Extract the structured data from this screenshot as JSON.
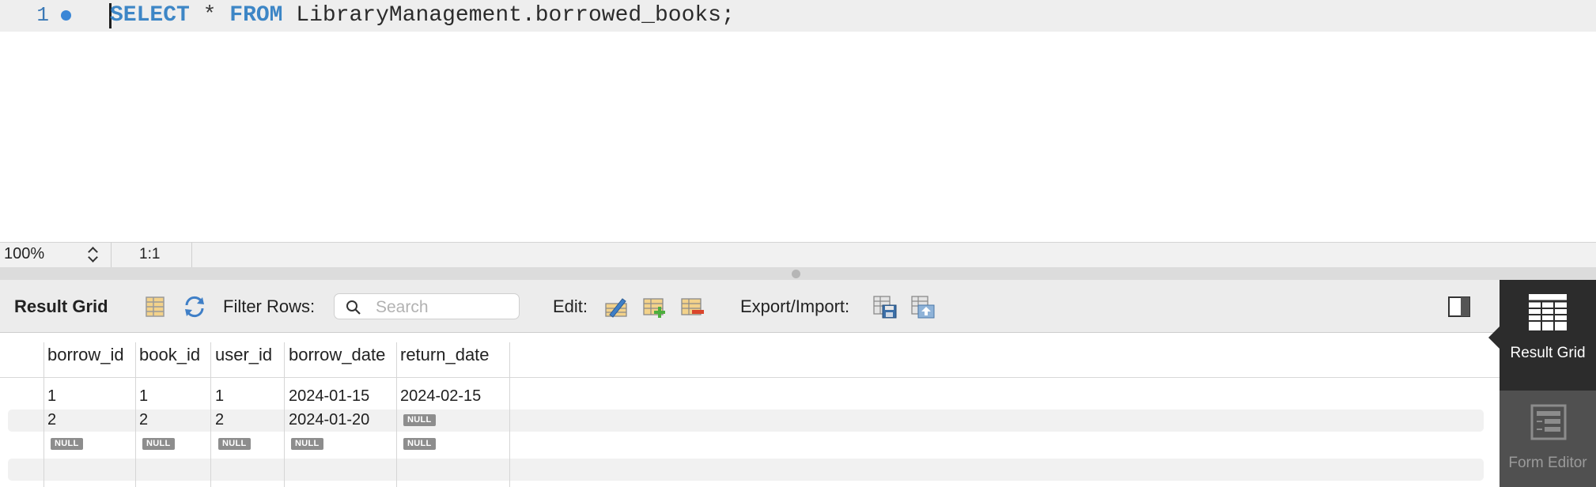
{
  "editor": {
    "line_number": "1",
    "query": {
      "kw_select": "SELECT",
      "star": "*",
      "kw_from": "FROM",
      "table": "LibraryManagement.borrowed_books;"
    }
  },
  "statusbar": {
    "zoom": "100%",
    "position": "1:1"
  },
  "toolbar": {
    "title": "Result Grid",
    "filter_label": "Filter Rows:",
    "search_placeholder": "Search",
    "edit_label": "Edit:",
    "export_label": "Export/Import:"
  },
  "grid": {
    "columns": [
      "borrow_id",
      "book_id",
      "user_id",
      "borrow_date",
      "return_date"
    ],
    "rows": [
      [
        "1",
        "1",
        "1",
        "2024-01-15",
        "2024-02-15"
      ],
      [
        "2",
        "2",
        "2",
        "2024-01-20",
        "NULL"
      ],
      [
        "NULL",
        "NULL",
        "NULL",
        "NULL",
        "NULL"
      ]
    ]
  },
  "sidepanel": {
    "result_grid": "Result Grid",
    "form_editor": "Form Editor"
  },
  "colors": {
    "keyword": "#3d86c6",
    "accent_dot": "#3a86d6",
    "side_active": "#2c2c2c",
    "null_badge": "#8d8d8d"
  },
  "icons": [
    "result-grid-layout-icon",
    "refresh-icon",
    "search-icon",
    "edit-row-icon",
    "add-row-icon",
    "delete-row-icon",
    "export-icon",
    "import-icon",
    "toggle-panel-icon",
    "result-grid-icon",
    "form-editor-icon"
  ]
}
